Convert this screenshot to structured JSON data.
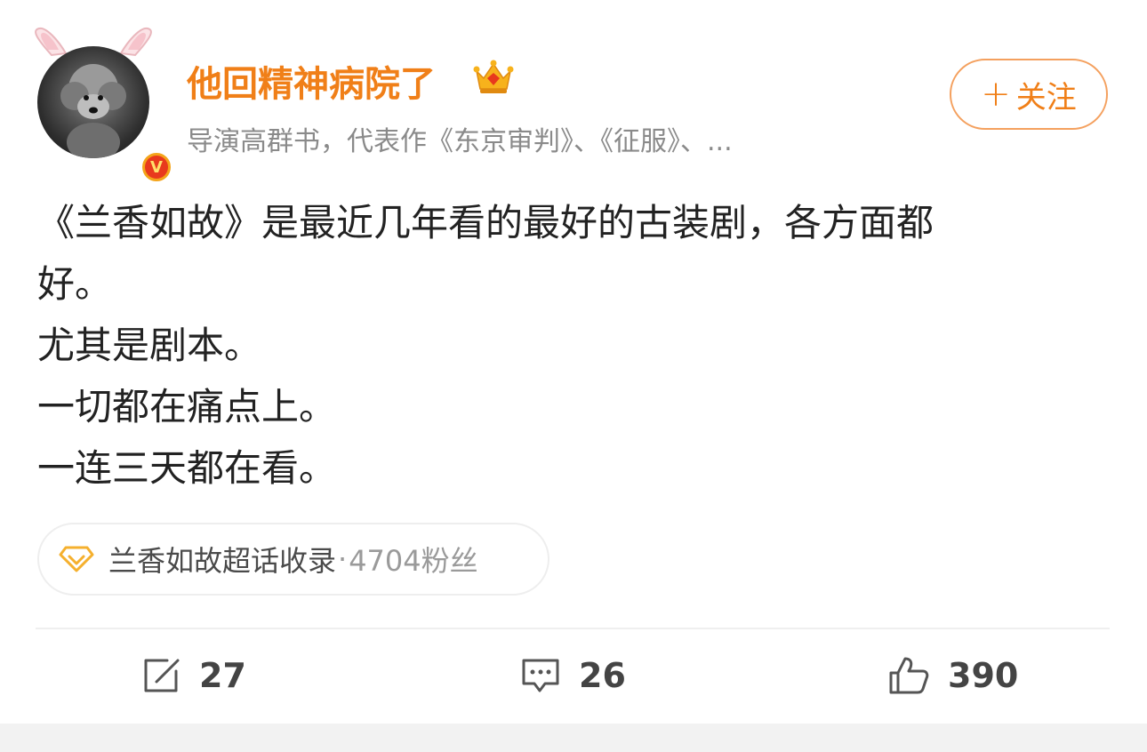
{
  "user": {
    "name": "他回精神病院了",
    "description": "导演高群书，代表作《东京审判》、《征服》、...",
    "verified_badge": "V"
  },
  "follow_button": {
    "plus": "+",
    "label": "关注"
  },
  "post": {
    "lines": [
      "《兰香如故》是最近几年看的最好的古装剧，各方面都",
      "好。",
      "尤其是剧本。",
      "一切都在痛点上。",
      "一连三天都在看。"
    ]
  },
  "topic": {
    "name": "兰香如故超话收录",
    "separator": "·",
    "fans": "4704粉丝"
  },
  "actions": {
    "repost": {
      "icon": "share-icon",
      "count": "27"
    },
    "comment": {
      "icon": "comment-icon",
      "count": "26"
    },
    "like": {
      "icon": "thumbs-up-icon",
      "count": "390"
    }
  },
  "colors": {
    "accent": "#f07f18",
    "follow_border": "#f4a05e",
    "verified": "#f4a41a"
  }
}
